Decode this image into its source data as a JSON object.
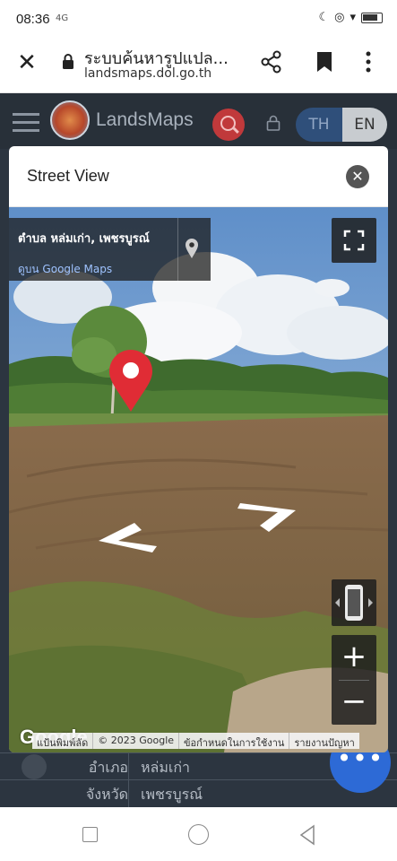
{
  "status_bar": {
    "time": "08:36",
    "signal_text": "4G"
  },
  "browser": {
    "page_title": "ระบบค้นหารูปแปล...",
    "url": "landsmaps.dol.go.th"
  },
  "site": {
    "brand": "LandsMaps",
    "lang_th": "TH",
    "lang_en": "EN",
    "info_rows": [
      {
        "key": "อำเภอ",
        "value": "หล่มเก่า"
      },
      {
        "key": "จังหวัด",
        "value": "เพชรบูรณ์"
      }
    ],
    "fab_label": "•••"
  },
  "modal": {
    "title": "Street View",
    "location_title": "ตำบล หล่มเก่า, เพชรบูรณ์",
    "view_on_google_maps": "ดูบน Google Maps",
    "google_logo": "Google",
    "attribution": {
      "shortcuts": "แป้นพิมพ์ลัด",
      "copyright": "© 2023 Google",
      "terms": "ข้อกำหนดในการใช้งาน",
      "report": "รายงานปัญหา"
    },
    "zoom_in": "+",
    "zoom_out": "−"
  },
  "colors": {
    "accent_red": "#c0393b",
    "fab_blue": "#2d6ad6",
    "header_dark": "#283039"
  }
}
